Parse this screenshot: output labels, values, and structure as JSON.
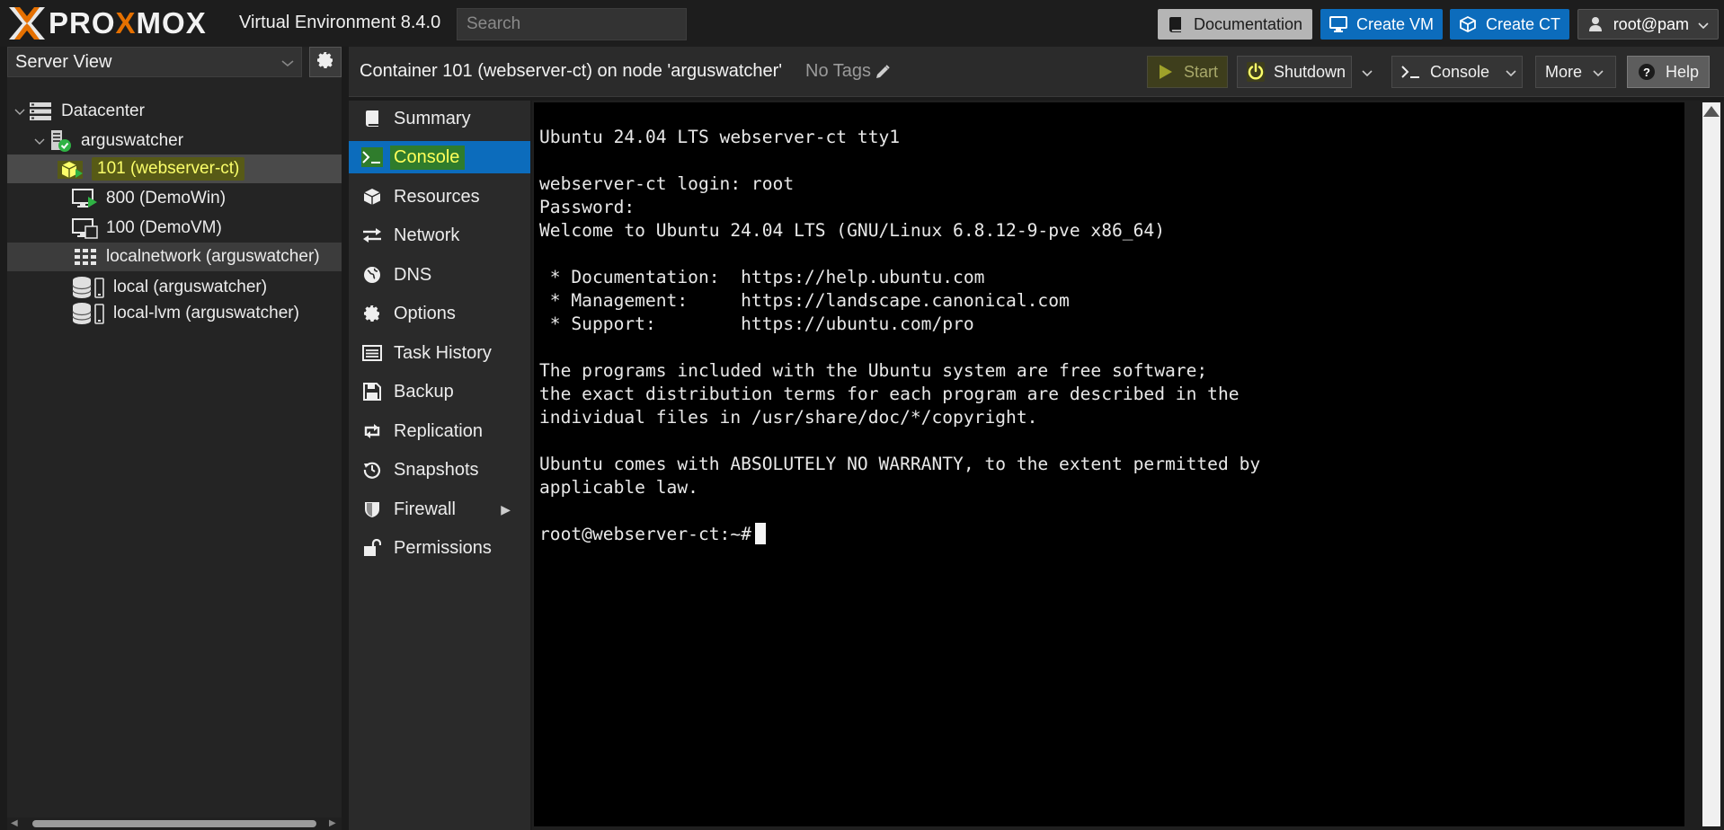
{
  "topbar": {
    "logo_prefix": "PRO",
    "logo_accent": "X",
    "logo_suffix": "MOX",
    "product": "Virtual Environment 8.4.0",
    "search_placeholder": "Search",
    "documentation": "Documentation",
    "create_vm": "Create VM",
    "create_ct": "Create CT",
    "user": "root@pam"
  },
  "left": {
    "view": "Server View",
    "tree": [
      {
        "label": "Datacenter",
        "icon": "datacenter-icon"
      },
      {
        "label": "arguswatcher",
        "icon": "node-online-icon"
      },
      {
        "label": "101 (webserver-ct)",
        "icon": "container-running-icon"
      },
      {
        "label": "800 (DemoWin)",
        "icon": "vm-running-icon"
      },
      {
        "label": "100 (DemoVM)",
        "icon": "vm-stopped-icon"
      },
      {
        "label": "localnetwork (arguswatcher)",
        "icon": "network-grid-icon"
      },
      {
        "label": "local (arguswatcher)",
        "icon": "storage-icon"
      },
      {
        "label": "local-lvm (arguswatcher)",
        "icon": "storage-icon"
      }
    ]
  },
  "header": {
    "title": "Container 101 (webserver-ct) on node 'arguswatcher'",
    "tags": "No Tags",
    "start": "Start",
    "shutdown": "Shutdown",
    "console": "Console",
    "more": "More",
    "help": "Help"
  },
  "nav": [
    {
      "label": "Summary",
      "icon": "book-icon"
    },
    {
      "label": "Console",
      "icon": "terminal-icon"
    },
    {
      "label": "Resources",
      "icon": "cube-icon"
    },
    {
      "label": "Network",
      "icon": "exchange-icon"
    },
    {
      "label": "DNS",
      "icon": "globe-icon"
    },
    {
      "label": "Options",
      "icon": "gear-icon"
    },
    {
      "label": "Task History",
      "icon": "list-icon"
    },
    {
      "label": "Backup",
      "icon": "floppy-icon"
    },
    {
      "label": "Replication",
      "icon": "retweet-icon"
    },
    {
      "label": "Snapshots",
      "icon": "history-icon"
    },
    {
      "label": "Firewall",
      "icon": "shield-icon"
    },
    {
      "label": "Permissions",
      "icon": "unlock-icon"
    }
  ],
  "terminal": {
    "lines": [
      "Ubuntu 24.04 LTS webserver-ct tty1",
      "",
      "webserver-ct login: root",
      "Password:",
      "Welcome to Ubuntu 24.04 LTS (GNU/Linux 6.8.12-9-pve x86_64)",
      "",
      " * Documentation:  https://help.ubuntu.com",
      " * Management:     https://landscape.canonical.com",
      " * Support:        https://ubuntu.com/pro",
      "",
      "The programs included with the Ubuntu system are free software;",
      "the exact distribution terms for each program are described in the",
      "individual files in /usr/share/doc/*/copyright.",
      "",
      "Ubuntu comes with ABSOLUTELY NO WARRANTY, to the extent permitted by",
      "applicable law.",
      ""
    ],
    "prompt": "root@webserver-ct:~#"
  },
  "colors": {
    "accent": "#0c6cbc",
    "logo_orange": "#e57000",
    "running_green": "#2fb344",
    "highlight_yellow": "#fbff6a"
  }
}
